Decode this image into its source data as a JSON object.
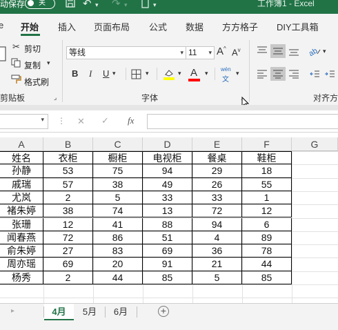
{
  "titlebar": {
    "autosave_label": "动保存",
    "toggle_label": "关",
    "doc_title": "工作簿1  -  Excel"
  },
  "tabs": [
    "开始",
    "插入",
    "页面布局",
    "公式",
    "数据",
    "方方格子",
    "DIY工具箱"
  ],
  "clipboard": {
    "cut": "剪切",
    "copy": "复制",
    "format_painter": "格式刷",
    "group_label": "剪贴板"
  },
  "font": {
    "name": "等线",
    "size": "11",
    "grow": "A",
    "shrink": "A",
    "bold": "B",
    "italic": "I",
    "underline": "U",
    "font_color_letter": "A",
    "phonetic_top": "wén",
    "phonetic_bottom": "文",
    "group_label": "字体"
  },
  "alignment": {
    "group_label": "对齐方"
  },
  "formula_bar": {
    "fx_label": "fx"
  },
  "sheet": {
    "columns": [
      "A",
      "B",
      "C",
      "D",
      "E",
      "F",
      "G"
    ],
    "header_row": [
      "姓名",
      "衣柜",
      "橱柜",
      "电视柜",
      "餐桌",
      "鞋柜"
    ],
    "rows": [
      [
        "孙静",
        "53",
        "75",
        "94",
        "29",
        "18"
      ],
      [
        "戚瑞",
        "57",
        "38",
        "49",
        "26",
        "55"
      ],
      [
        "尤岚",
        "2",
        "5",
        "33",
        "33",
        "1"
      ],
      [
        "褚朱婷",
        "38",
        "74",
        "13",
        "72",
        "12"
      ],
      [
        "张珊",
        "12",
        "41",
        "88",
        "94",
        "6"
      ],
      [
        "闻春燕",
        "72",
        "86",
        "51",
        "4",
        "89"
      ],
      [
        "俞朱婷",
        "27",
        "83",
        "69",
        "36",
        "78"
      ],
      [
        "周亦瑶",
        "69",
        "20",
        "91",
        "21",
        "44"
      ],
      [
        "杨秀",
        "2",
        "44",
        "85",
        "5",
        "85"
      ]
    ]
  },
  "sheet_tabs": [
    "4月",
    "5月",
    "6月"
  ],
  "colors": {
    "accent": "#217346",
    "font_highlight": "#ffff00",
    "font_color": "#ff0000"
  }
}
